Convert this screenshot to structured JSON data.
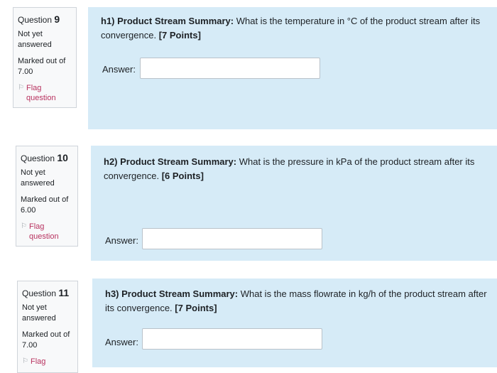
{
  "questions": [
    {
      "prefix": "Question",
      "number": "9",
      "state": "Not yet answered",
      "grade_line1": "Marked out of",
      "grade_line2": "7.00",
      "flag": "Flag question",
      "title": "h1) Product Stream Summary:",
      "text": " What is the temperature in °C of the product stream after its convergence.",
      "points": "[7 Points]",
      "answer_label": "Answer:",
      "answer_value": ""
    },
    {
      "prefix": "Question",
      "number": "10",
      "state": "Not yet answered",
      "grade_line1": "Marked out of",
      "grade_line2": "6.00",
      "flag": "Flag question",
      "title": "h2) Product Stream Summary:",
      "text": " What is the pressure in kPa of the product stream after its convergence.",
      "points": "[6 Points]",
      "answer_label": "Answer:",
      "answer_value": ""
    },
    {
      "prefix": "Question",
      "number": "11",
      "state": "Not yet answered",
      "grade_line1": "Marked out of",
      "grade_line2": "7.00",
      "flag": "Flag",
      "title": "h3) Product Stream Summary:",
      "text": " What is the mass flowrate in kg/h of the product stream after its convergence.",
      "points": "[7 Points]",
      "answer_label": "Answer:",
      "answer_value": ""
    }
  ]
}
